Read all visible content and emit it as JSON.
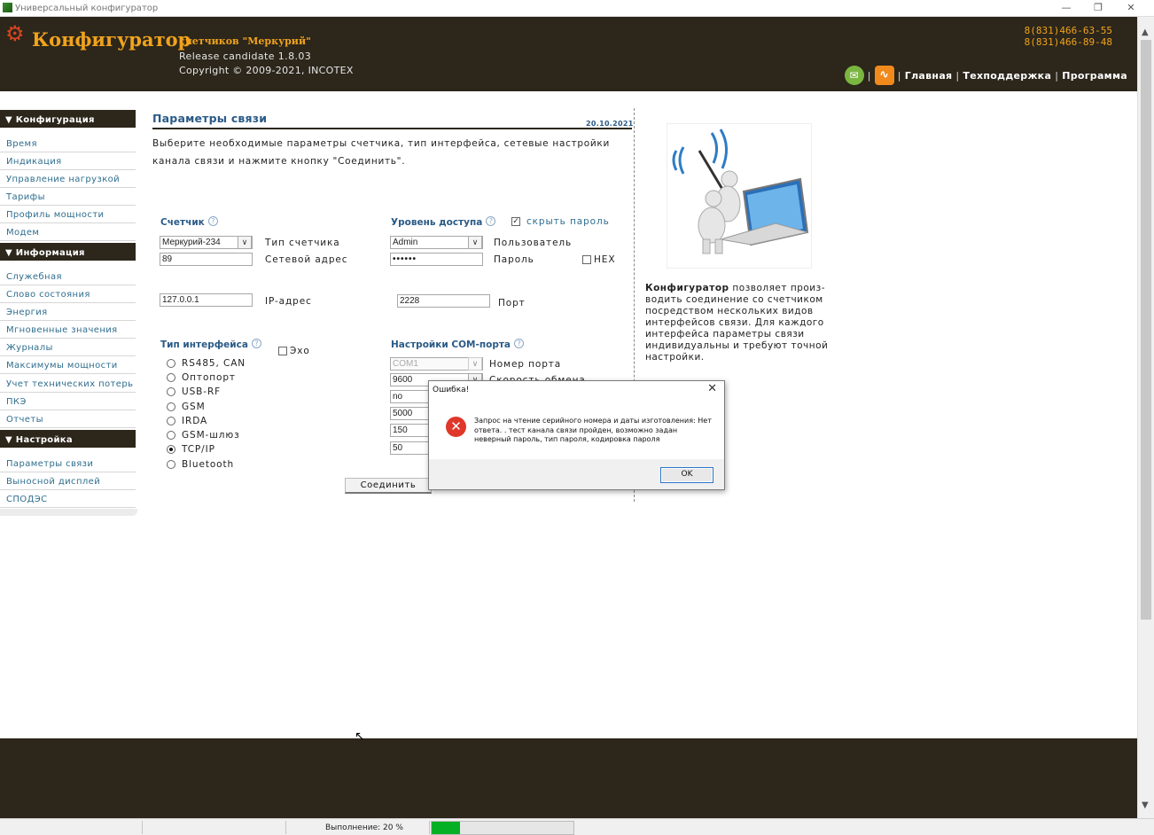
{
  "window": {
    "title": "Универсальный конфигуратор"
  },
  "header": {
    "logo": "Конфигуратор",
    "subtitle": "счетчиков \"Меркурий\"",
    "release": "Release candidate 1.8.03",
    "copyright": "Copyright © 2009-2021, INCOTEX",
    "phone1": "8(831)466-63-55",
    "phone2": "8(831)466-89-48",
    "nav": [
      "Главная",
      "Техподдержка",
      "Программа"
    ],
    "colors": {
      "band": "#2c261b",
      "accent": "#f0a31c"
    }
  },
  "sidebar": {
    "sections": [
      {
        "title": "▼ Конфигурация",
        "items": [
          "Время",
          "Индикация",
          "Управление нагрузкой",
          "Тарифы",
          "Профиль мощности",
          "Модем"
        ]
      },
      {
        "title": "▼ Информация",
        "items": [
          "Служебная",
          "Слово состояния",
          "Энергия",
          "Мгновенные значения",
          "Журналы",
          "Максимумы мощности",
          "Учет технических потерь",
          "ПКЭ",
          "Отчеты"
        ]
      },
      {
        "title": "▼ Настройка",
        "items": [
          "Параметры связи",
          "Выносной дисплей",
          "СПОДЭС"
        ]
      }
    ]
  },
  "main": {
    "title": "Параметры связи",
    "date": "20.10.2021",
    "intro": "Выберите необходимые параметры счетчика, тип интерфейса, сетевые настройки канала связи и нажмите кнопку \"Соединить\".",
    "meter": {
      "title": "Счетчик",
      "type_value": "Меркурий-234",
      "type_label": "Тип счетчика",
      "address_value": "89",
      "address_label": "Сетевой адрес"
    },
    "access": {
      "title": "Уровень доступа",
      "hide_password_label": "скрыть пароль",
      "hide_password_checked": true,
      "user_value": "Admin",
      "user_label": "Пользователь",
      "password_value": "••••••",
      "password_label": "Пароль",
      "hex_label": "HEX",
      "hex_checked": false
    },
    "network": {
      "ip_value": "127.0.0.1",
      "ip_label": "IP-адрес",
      "port_value": "2228",
      "port_label": "Порт"
    },
    "interface": {
      "title": "Тип интерфейса",
      "echo_label": "Эхо",
      "options": [
        "RS485, CAN",
        "Оптопорт",
        "USB-RF",
        "GSM",
        "IRDA",
        "GSM-шлюз",
        "TCP/IP",
        "Bluetooth"
      ],
      "selected": "TCP/IP"
    },
    "com": {
      "title": "Настройки COM-порта",
      "port_value": "COM1",
      "port_label": "Номер порта",
      "baud_value": "9600",
      "baud_label": "Скорость обмена",
      "parity_value": "no",
      "timeout1": "5000",
      "timeout2": "150",
      "timeout3": "50"
    },
    "connect_button": "Соединить"
  },
  "aside": {
    "description_bold": "Конфигуратор",
    "description": " позволяет произ-водить соединение со счетчиком посредством нескольких видов интерфейсов связи. Для каждого интерфейса параметры связи индивидуальны и требуют точной настройки."
  },
  "dialog": {
    "title": "Ошибка!",
    "message": "Запрос на чтение серийного номера и даты изготовления: Нет ответа. . тест канала связи пройден, возможно задан неверный пароль, тип пароля, кодировка пароля",
    "ok": "OK",
    "icon": "error-icon"
  },
  "statusbar": {
    "progress_label": "Выполнение: 20 %",
    "progress": 0.2
  }
}
